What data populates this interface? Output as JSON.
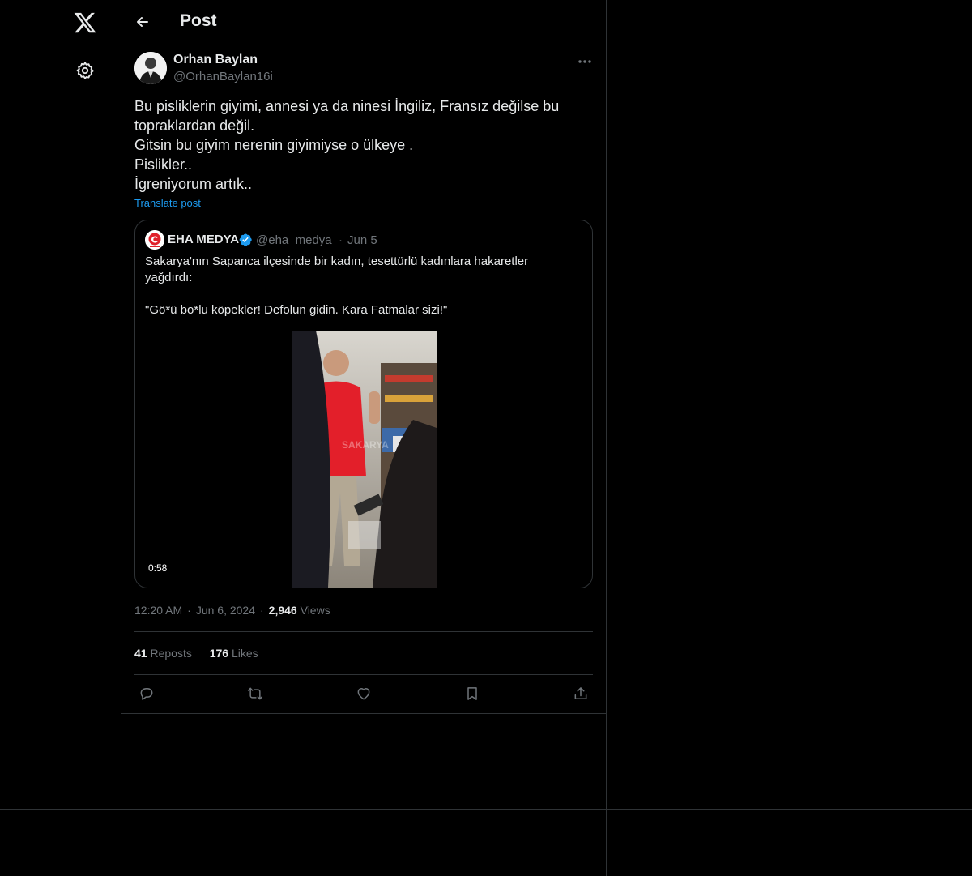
{
  "nav": {
    "logo_icon": "x-logo-icon",
    "settings_icon": "gear-icon"
  },
  "header": {
    "title": "Post",
    "back_icon": "arrow-left-icon"
  },
  "post": {
    "author_name": "Orhan Baylan",
    "author_handle": "@OrhanBaylan16i",
    "text_lines": [
      "Bu pisliklerin giyimi, annesi ya da ninesi İngiliz, Fransız değilse bu",
      "topraklardan değil.",
      "Gitsin bu giyim nerenin giyimiyse o ülkeye .",
      "Pislikler..",
      "İgreniyorum artık.."
    ],
    "translate_label": "Translate post",
    "time": "12:20 AM",
    "date": "Jun 6, 2024",
    "views_count": "2,946",
    "views_label": "Views",
    "reposts_count": "41",
    "reposts_label": "Reposts",
    "likes_count": "176",
    "likes_label": "Likes"
  },
  "quoted": {
    "name": "EHA MEDYA",
    "handle": "@eha_medya",
    "dot": "·",
    "date": "Jun 5",
    "text_lines": [
      "Sakarya'nın Sapanca ilçesinde bir kadın, tesettürlü kadınlara hakaretler",
      "yağdırdı:",
      "",
      "\"Gö*ü bo*lu köpekler! Defolun gidin. Kara Fatmalar sizi!\""
    ],
    "video_duration": "0:58",
    "verified_color": "#1d9bf0"
  },
  "colors": {
    "background": "#000000",
    "border": "#2f3336",
    "text_primary": "#e7e9ea",
    "text_secondary": "#71767b",
    "accent": "#1d9bf0"
  }
}
